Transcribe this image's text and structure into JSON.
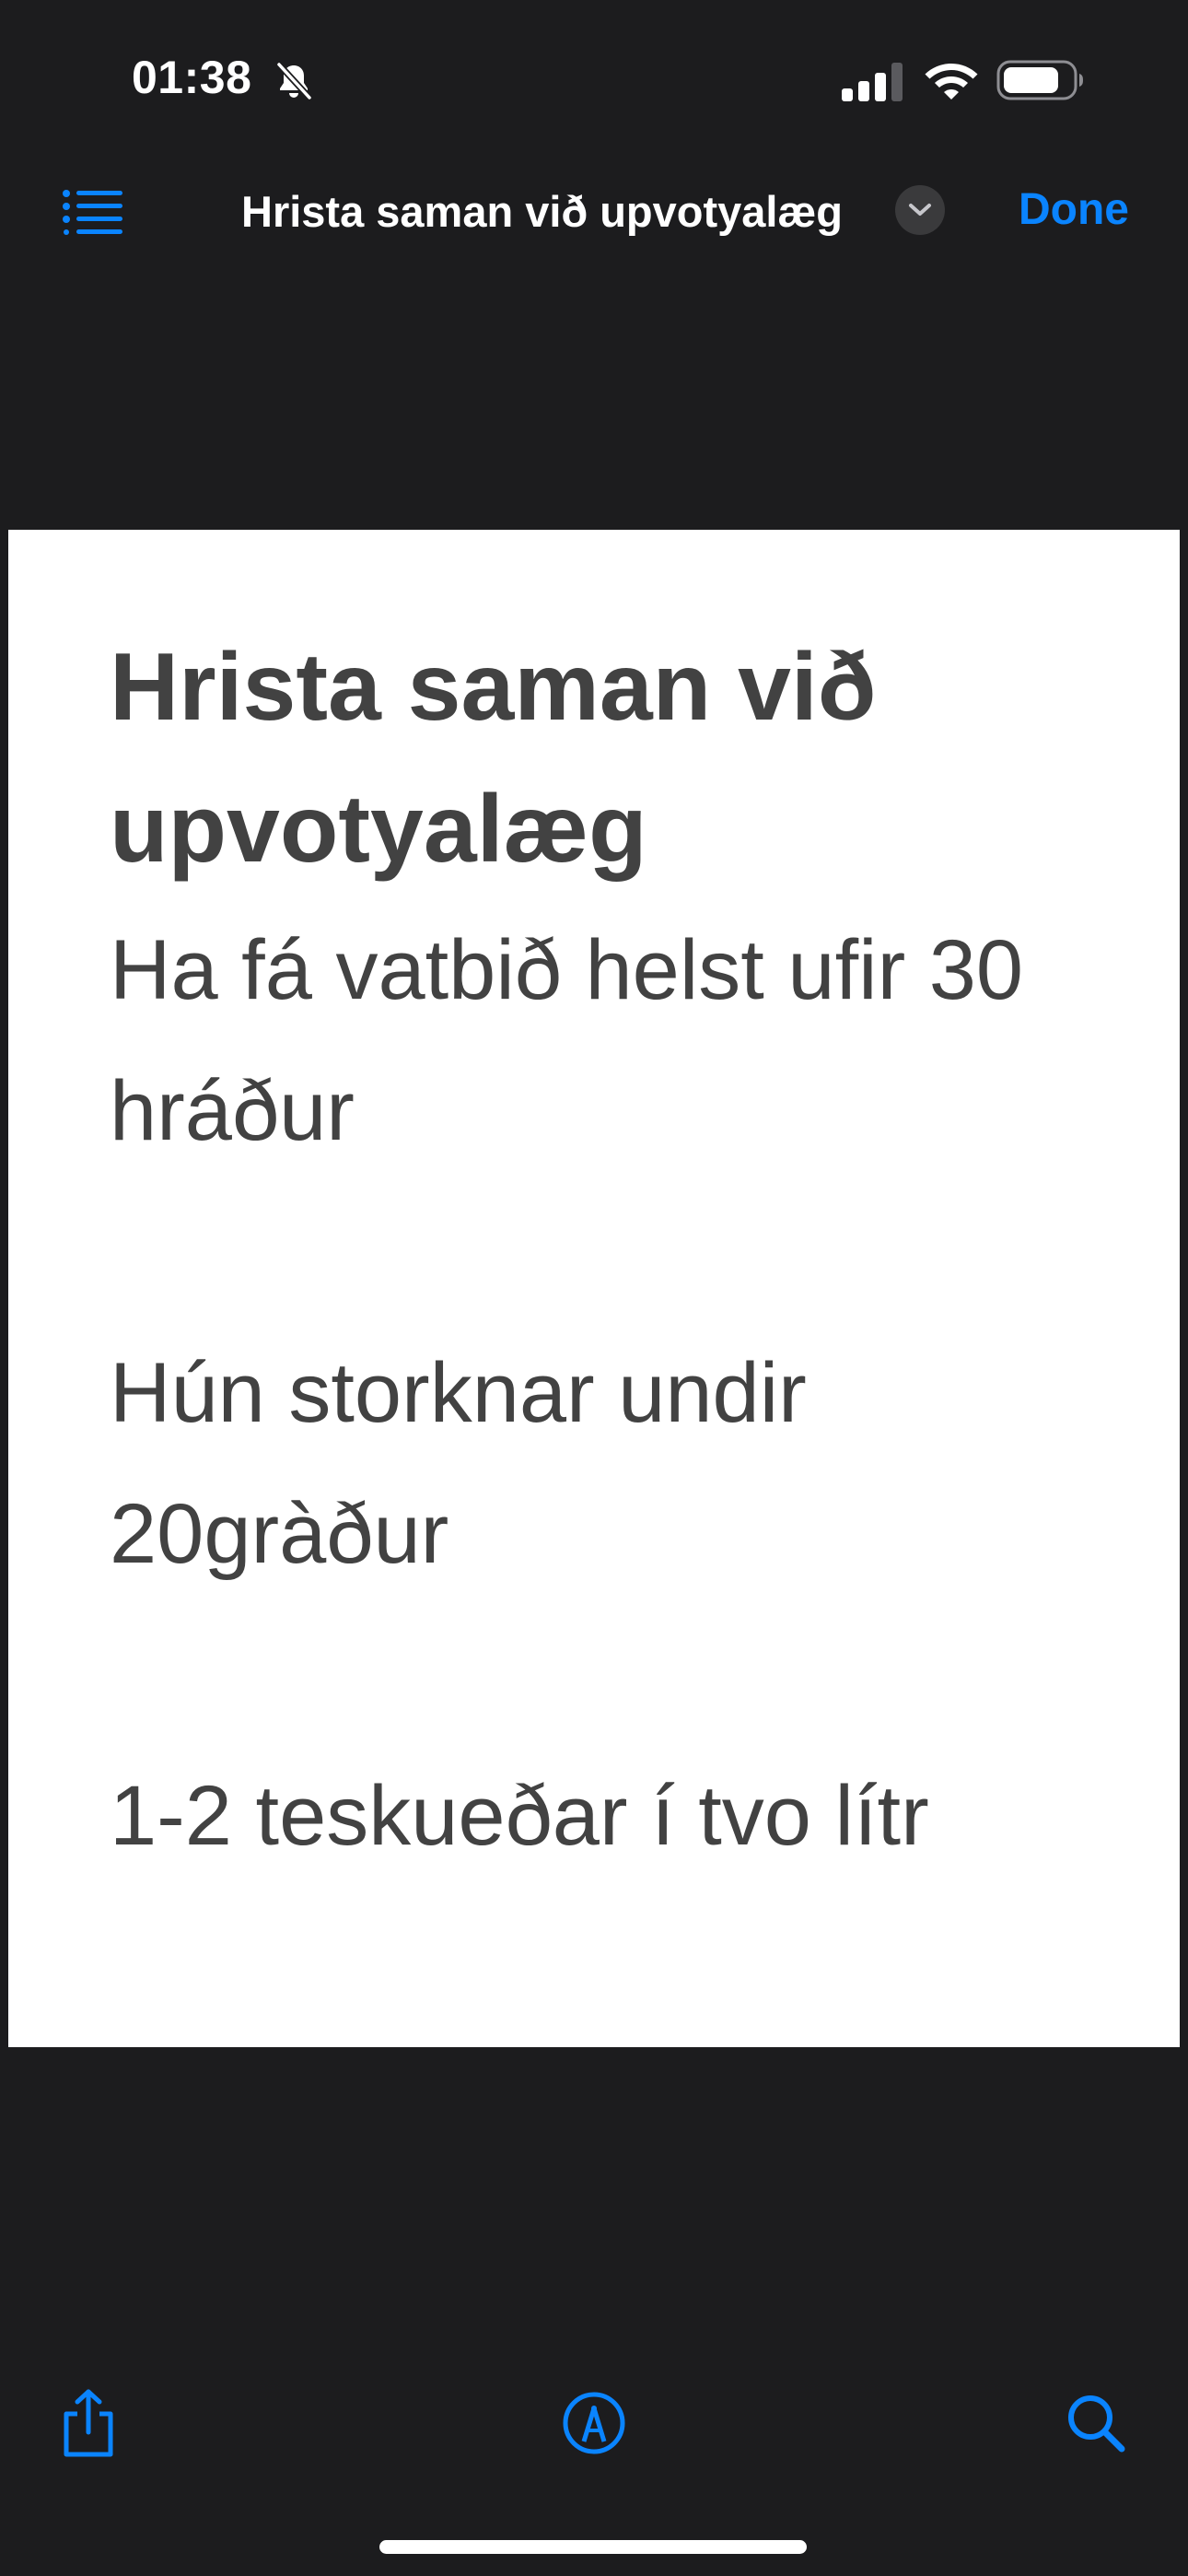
{
  "status_bar": {
    "time": "01:38",
    "icons": [
      "bell-slash-icon",
      "cellular-signal-icon",
      "wifi-icon",
      "battery-icon"
    ]
  },
  "nav_bar": {
    "menu_icon": "list-icon",
    "title": "Hrista saman við upvotyalæg",
    "title_menu_icon": "chevron-down-icon",
    "done_label": "Done"
  },
  "document": {
    "heading": "Hrista saman við upvotyalæg",
    "paragraphs": [
      "Ha fá vatbið helst ufir 30 hráður",
      "Hún storknar undir 20gràður",
      "1-2 teskueðar í tvo lítr"
    ]
  },
  "toolbar": {
    "icons": [
      "share-icon",
      "markup-pen-icon",
      "search-icon"
    ]
  },
  "colors": {
    "background": "#1c1c1e",
    "accent": "#0a84ff",
    "page": "#ffffff",
    "text": "#424242"
  }
}
